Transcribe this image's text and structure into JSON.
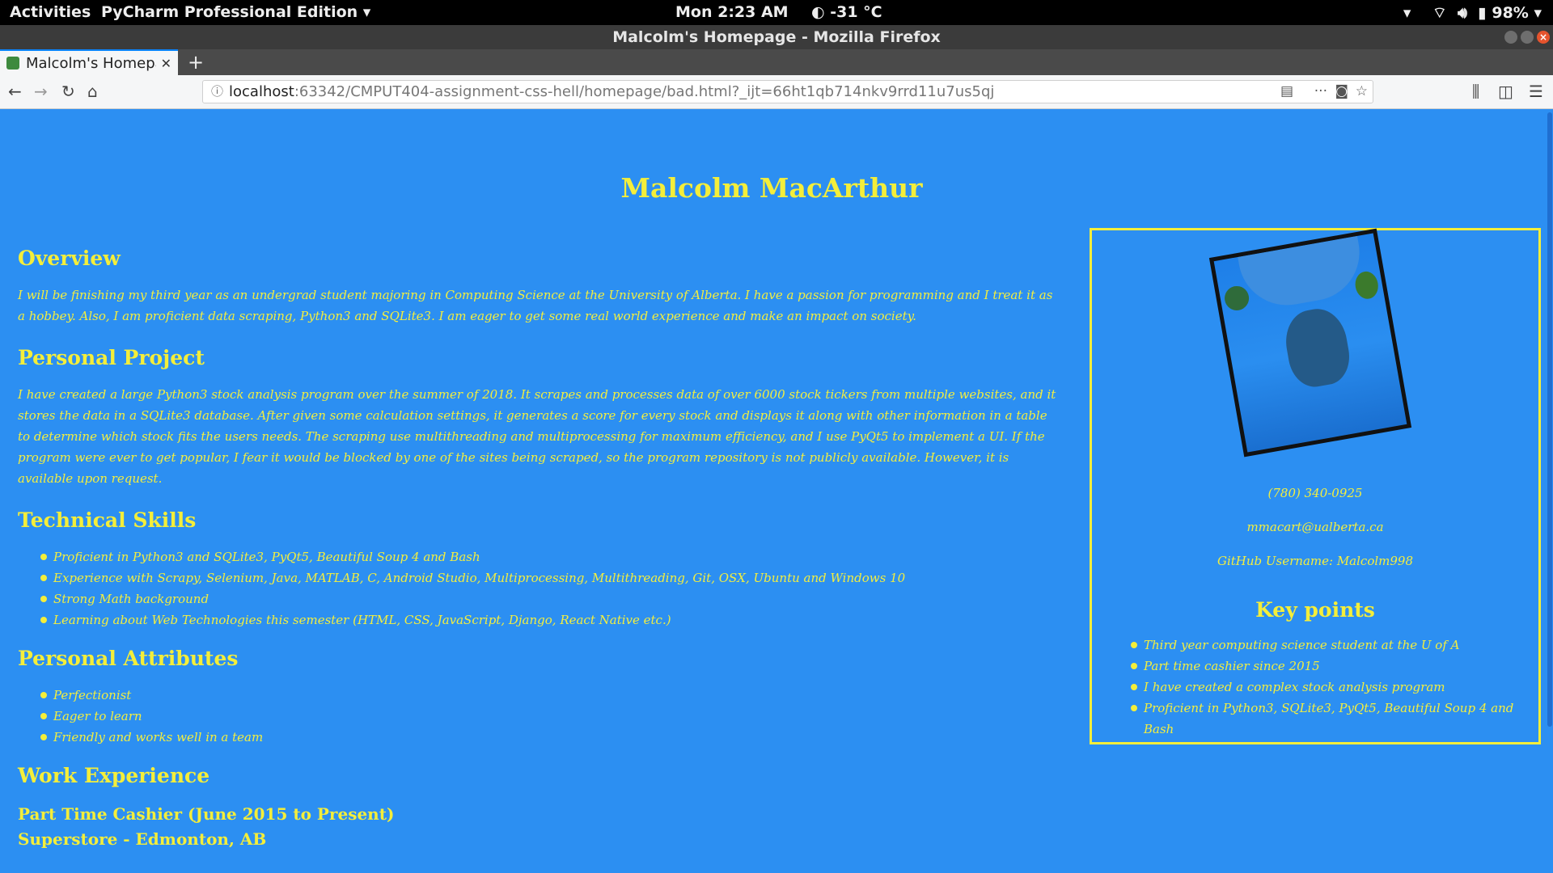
{
  "topbar": {
    "activities": "Activities",
    "app_menu": "PyCharm Professional Edition ▾",
    "clock": "Mon  2:23 AM",
    "weather": "-31 °C",
    "battery": "98%"
  },
  "window": {
    "title": "Malcolm's Homepage - Mozilla Firefox"
  },
  "tabs": [
    {
      "title": "Malcolm's Homepage",
      "active": true
    }
  ],
  "navbar": {
    "url_host": "localhost",
    "url_rest": ":63342/CMPUT404-assignment-css-hell/homepage/bad.html?_ijt=66ht1qb714nkv9rrd11u7us5qj"
  },
  "page": {
    "title": "Malcolm MacArthur",
    "overview": {
      "heading": "Overview",
      "text": "I will be finishing my third year as an undergrad student majoring in Computing Science at the University of Alberta. I have a passion for programming and I treat it as a hobbey. Also, I am proficient data scraping, Python3 and SQLite3. I am eager to get some real world experience and make an impact on society."
    },
    "project": {
      "heading": "Personal Project",
      "text": "I have created a large Python3 stock analysis program over the summer of 2018. It scrapes and processes data of over 6000 stock tickers from multiple websites, and it stores the data in a SQLite3 database. After given some calculation settings, it generates a score for every stock and displays it along with other information in a table to determine which stock fits the users needs. The scraping use multithreading and multiprocessing for maximum efficiency, and I use PyQt5 to implement a UI. If the program were ever to get popular, I fear it would be blocked by one of the sites being scraped, so the program repository is not publicly available. However, it is available upon request."
    },
    "skills": {
      "heading": "Technical Skills",
      "items": [
        "Proficient in Python3 and SQLite3, PyQt5, Beautiful Soup 4 and Bash",
        "Experience with Scrapy, Selenium, Java, MATLAB, C, Android Studio, Multiprocessing, Multithreading, Git, OSX, Ubuntu and Windows 10",
        "Strong Math background",
        "Learning about Web Technologies this semester (HTML, CSS, JavaScript, Django, React Native etc.)"
      ]
    },
    "attributes": {
      "heading": "Personal Attributes",
      "items": [
        "Perfectionist",
        "Eager to learn",
        "Friendly and works well in a team"
      ]
    },
    "work": {
      "heading": "Work Experience",
      "job_title": "Part Time Cashier (June 2015 to Present)",
      "job_place": "Superstore - Edmonton, AB"
    },
    "sidebar": {
      "phone": "(780) 340-0925",
      "email": "mmacart@ualberta.ca",
      "github": "GitHub Username: Malcolm998",
      "heading": "Key points",
      "items": [
        "Third year computing science student at the U of A",
        "Part time cashier since 2015",
        "I have created a complex stock analysis program",
        "Proficient in Python3, SQLite3, PyQt5, Beautiful Soup 4 and Bash"
      ]
    }
  }
}
